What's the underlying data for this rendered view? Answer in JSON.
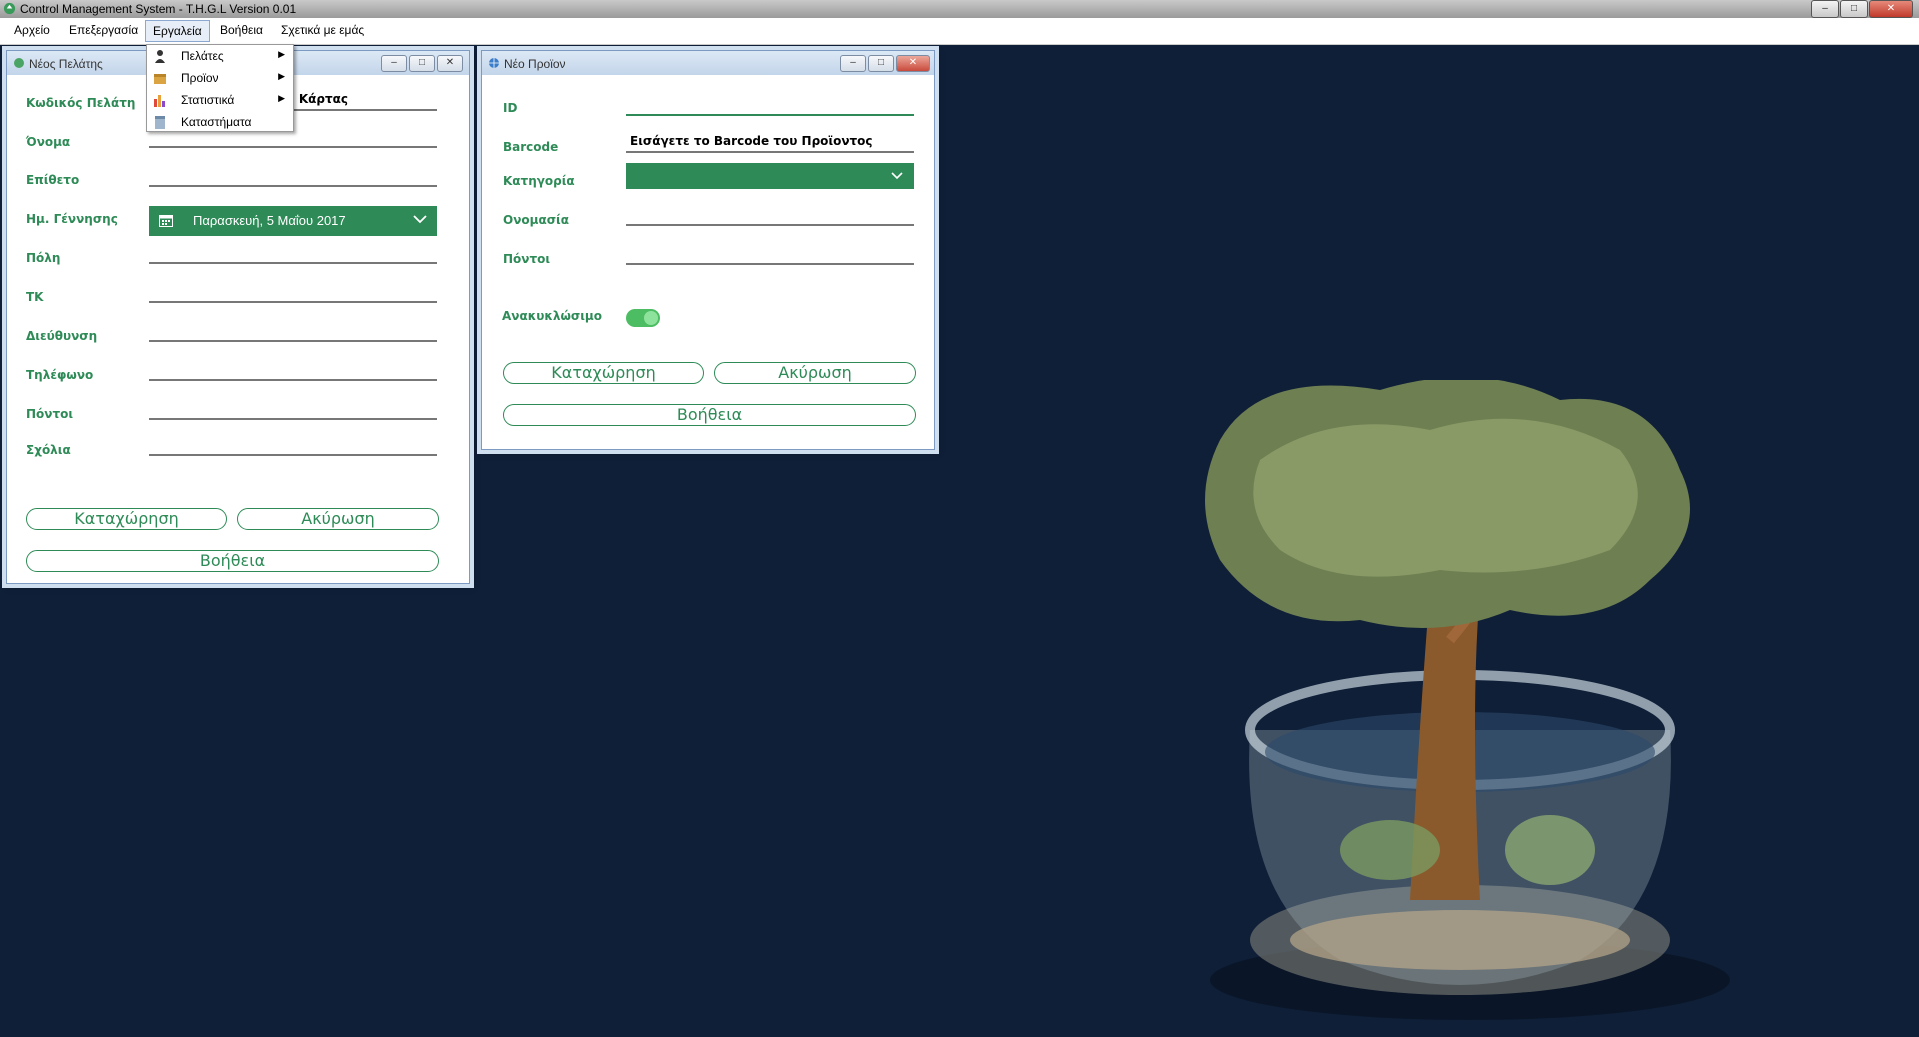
{
  "app": {
    "title": "Control Management System - T.H.G.L Version 0.01",
    "window_controls": {
      "minimize": "–",
      "maximize": "□",
      "close": "✕"
    }
  },
  "menu": {
    "items": [
      {
        "label": "Αρχείο"
      },
      {
        "label": "Επεξεργασία"
      },
      {
        "label": "Εργαλεία"
      },
      {
        "label": "Βοήθεια"
      },
      {
        "label": "Σχετικά με εμάς"
      }
    ],
    "open_index": 2,
    "dropdown": [
      {
        "label": "Πελάτες",
        "icon": "person-icon",
        "has_submenu": true,
        "arrow": "▶"
      },
      {
        "label": "Προϊον",
        "icon": "box-icon",
        "has_submenu": true,
        "arrow": "▶"
      },
      {
        "label": "Στατιστικά",
        "icon": "bar-chart-icon",
        "has_submenu": true,
        "arrow": "▶"
      },
      {
        "label": "Καταστήματα",
        "icon": "store-icon",
        "has_submenu": false
      }
    ]
  },
  "customer_window": {
    "title": "Νέος Πελάτης",
    "card_code_value": "ης Κάρτας",
    "fields": [
      {
        "label": "Κωδικός Πελάτη"
      },
      {
        "label": "Όνομα"
      },
      {
        "label": "Επίθετο"
      },
      {
        "label": "Ημ. Γέννησης"
      },
      {
        "label": "Πόλη"
      },
      {
        "label": "ΤΚ"
      },
      {
        "label": "Διεύθυνση"
      },
      {
        "label": "Τηλέφωνο"
      },
      {
        "label": "Πόντοι"
      },
      {
        "label": "Σχόλια"
      }
    ],
    "birth_date": "Παρασκευή, 5 Μαΐου 2017",
    "buttons": {
      "submit": "Καταχώρηση",
      "cancel": "Ακύρωση",
      "help": "Βοήθεια"
    }
  },
  "product_window": {
    "title": "Νέο Προϊον",
    "fields": [
      {
        "label": "ID"
      },
      {
        "label": "Barcode"
      },
      {
        "label": "Κατηγορία"
      },
      {
        "label": "Ονομασία"
      },
      {
        "label": "Πόντοι"
      }
    ],
    "barcode_value": "Εισάγετε το Barcode του Προϊοντος",
    "category_value": "",
    "recyclable_label": "Ανακυκλώσιμο",
    "recyclable_on": true,
    "buttons": {
      "submit": "Καταχώρηση",
      "cancel": "Ακύρωση",
      "help": "Βοήθεια"
    }
  },
  "colors": {
    "accent": "#2e8b57",
    "desktop": "#0f1f38",
    "toggle": "#4cbd62"
  }
}
